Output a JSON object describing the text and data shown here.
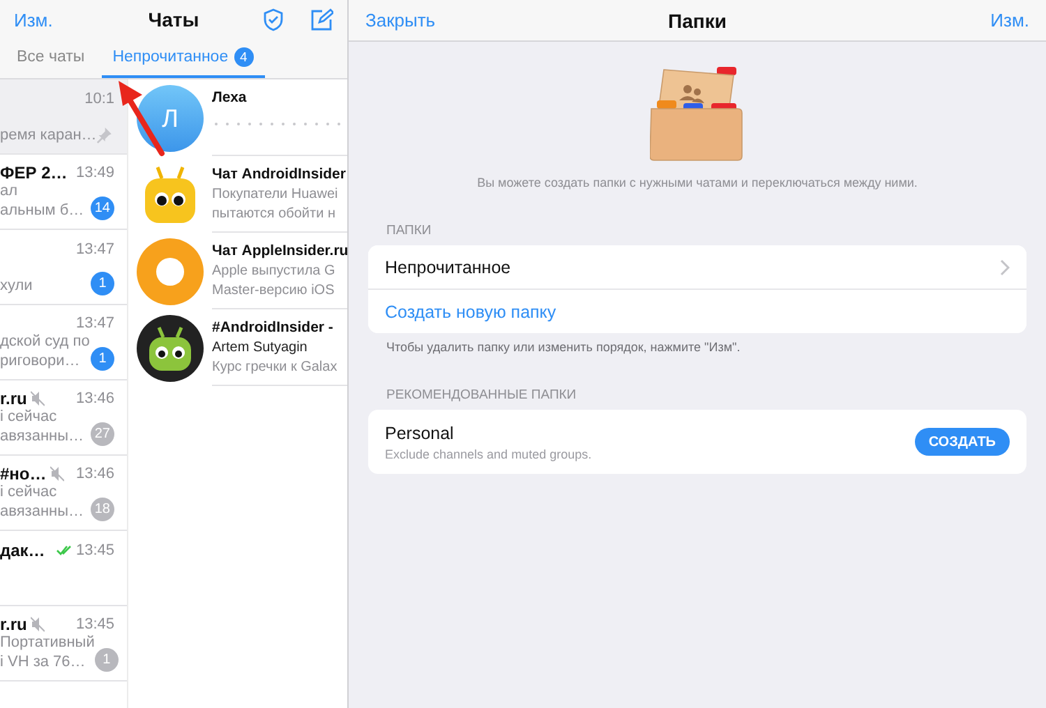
{
  "chats": {
    "edit": "Изм.",
    "title": "Чаты",
    "tabs": [
      {
        "label": "Все чаты",
        "selected": false
      },
      {
        "label": "Непрочитанное",
        "selected": true,
        "count": "4"
      }
    ],
    "background_rows": [
      {
        "time": "10:1",
        "pinned": true,
        "muted": false,
        "read": false,
        "preview": [
          "ремя каран…"
        ]
      },
      {
        "title": "ФЕР 2…",
        "time": "13:49",
        "pinned": false,
        "muted": false,
        "read": false,
        "preview": [
          "ал",
          "альным б…"
        ],
        "badge": "14"
      },
      {
        "time": "13:47",
        "pinned": false,
        "muted": false,
        "read": false,
        "preview": [
          "хули"
        ],
        "badge": "1"
      },
      {
        "time": "13:47",
        "pinned": false,
        "muted": false,
        "read": false,
        "preview": [
          "дской суд по",
          "риговори…"
        ],
        "badge": "1"
      },
      {
        "title": "r.ru",
        "time": "13:46",
        "pinned": false,
        "muted": true,
        "read": false,
        "preview": [
          "і сейчас",
          "авязанны…"
        ],
        "badge": "27"
      },
      {
        "title": "#но…",
        "time": "13:46",
        "pinned": false,
        "muted": true,
        "read": false,
        "preview": [
          "і сейчас",
          "авязанны…"
        ],
        "badge": "18"
      },
      {
        "title": "дак…",
        "time": "13:45",
        "pinned": false,
        "muted": false,
        "read": true,
        "preview": []
      },
      {
        "title": "r.ru",
        "time": "13:45",
        "pinned": false,
        "muted": true,
        "read": false,
        "preview": [
          "Портативный",
          "і VH за 76…"
        ],
        "badge": "1"
      }
    ],
    "unread_rows": [
      {
        "avatar": {
          "kind": "letter",
          "letter": "Л"
        },
        "title": "Леха",
        "preview_hidden": true,
        "lines": []
      },
      {
        "avatar": {
          "kind": "bot"
        },
        "title": "Чат AndroidInsider",
        "preview_hidden": false,
        "lines": [
          "Покупатели Huawei",
          "пытаются обойти н"
        ]
      },
      {
        "avatar": {
          "kind": "ring"
        },
        "title": "Чат AppleInsider.ru",
        "preview_hidden": false,
        "lines": [
          "Apple выпустила G",
          "Master-версию iOS"
        ]
      },
      {
        "avatar": {
          "kind": "dark-bot"
        },
        "title": "#AndroidInsider -",
        "preview_hidden": false,
        "sender": "Artem Sutyagin",
        "lines": [
          "Курс гречки к Galax"
        ]
      }
    ]
  },
  "folders": {
    "close": "Закрыть",
    "title": "Папки",
    "edit": "Изм.",
    "intro": "Вы можете создать папки с нужными чатами и переключаться между ними.",
    "my_section": {
      "label": "ПАПКИ",
      "items": [
        {
          "kind": "folder",
          "label": "Непрочитанное"
        },
        {
          "kind": "action",
          "label": "Создать новую папку"
        }
      ],
      "hint": "Чтобы удалить папку или изменить порядок, нажмите \"Изм\"."
    },
    "recommended": {
      "label": "РЕКОМЕНДОВАННЫЕ ПАПКИ",
      "items": [
        {
          "name": "Personal",
          "description": "Exclude channels and muted groups.",
          "button": "СОЗДАТЬ"
        }
      ]
    }
  }
}
